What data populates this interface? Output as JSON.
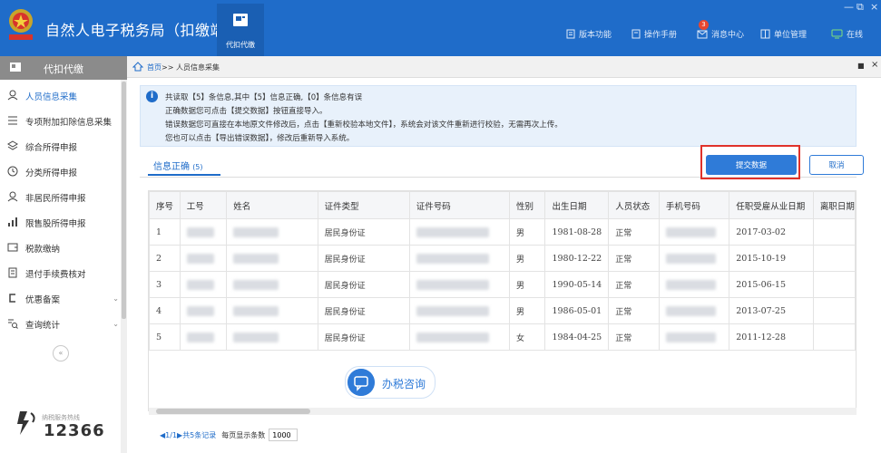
{
  "header": {
    "app_title": "自然人电子税务局（扣缴端）",
    "module_tab": "代扣代缴",
    "nav": [
      {
        "label": "版本功能",
        "icon": "document-icon"
      },
      {
        "label": "操作手册",
        "icon": "manual-icon"
      },
      {
        "label": "消息中心",
        "icon": "mail-icon"
      },
      {
        "label": "单位管理",
        "icon": "building-icon"
      },
      {
        "label": "在线",
        "icon": "online-icon"
      }
    ],
    "message_badge": "3",
    "window_controls": [
      "—",
      "⧉",
      "×"
    ]
  },
  "sidebar": {
    "title": "代扣代缴",
    "items": [
      {
        "label": "人员信息采集",
        "icon": "person-icon",
        "active": true
      },
      {
        "label": "专项附加扣除信息采集",
        "icon": "list-icon"
      },
      {
        "label": "综合所得申报",
        "icon": "layers-icon"
      },
      {
        "label": "分类所得申报",
        "icon": "clock-icon"
      },
      {
        "label": "非居民所得申报",
        "icon": "person-icon"
      },
      {
        "label": "限售股所得申报",
        "icon": "bar-chart-icon"
      },
      {
        "label": "税款缴纳",
        "icon": "wallet-icon"
      },
      {
        "label": "退付手续费核对",
        "icon": "receipt-icon"
      },
      {
        "label": "优惠备案",
        "icon": "bracket-icon",
        "expandable": true
      },
      {
        "label": "查询统计",
        "icon": "search-list-icon",
        "expandable": true
      }
    ],
    "collapse": "«",
    "hotline_label": "纳税服务热线",
    "hotline_number": "12366"
  },
  "breadcrumb": {
    "home": "首页",
    "separator": ">>",
    "current": "人员信息采集"
  },
  "notice": {
    "lines": [
      "共读取【5】条信息,其中【5】信息正确,【0】条信息有误",
      "正确数据您可点击【提交数据】按钮直接导入。",
      "错误数据您可直接在本地原文件修改后，点击【重新校验本地文件】，系统会对该文件重新进行校验，无需再次上传。",
      "您也可以点击【导出错误数据】，修改后重新导入系统。"
    ]
  },
  "tab": {
    "label": "信息正确",
    "count": "(5)"
  },
  "buttons": {
    "submit": "提交数据",
    "cancel": "取消"
  },
  "table": {
    "columns": [
      "序号",
      "工号",
      "姓名",
      "证件类型",
      "证件号码",
      "性别",
      "出生日期",
      "人员状态",
      "手机号码",
      "任职受雇从业日期",
      "离职日期"
    ],
    "rows": [
      {
        "no": "1",
        "id_type": "居民身份证",
        "gender": "男",
        "birth": "1981-08-28",
        "status": "正常",
        "hire": "2017-03-02"
      },
      {
        "no": "2",
        "id_type": "居民身份证",
        "gender": "男",
        "birth": "1980-12-22",
        "status": "正常",
        "hire": "2015-10-19"
      },
      {
        "no": "3",
        "id_type": "居民身份证",
        "gender": "男",
        "birth": "1990-05-14",
        "status": "正常",
        "hire": "2015-06-15"
      },
      {
        "no": "4",
        "id_type": "居民身份证",
        "gender": "男",
        "birth": "1986-05-01",
        "status": "正常",
        "hire": "2013-07-25"
      },
      {
        "no": "5",
        "id_type": "居民身份证",
        "gender": "女",
        "birth": "1984-04-25",
        "status": "正常",
        "hire": "2011-12-28"
      }
    ]
  },
  "consult_button": "办税咨询",
  "pager": {
    "page": "1/1",
    "total": "共5条记录",
    "per_page_label": "每页显示条数",
    "per_page_value": "1000"
  },
  "colors": {
    "brand_blue": "#1f6cc9",
    "highlight_red": "#e0322a",
    "badge_red": "#e8462f"
  }
}
